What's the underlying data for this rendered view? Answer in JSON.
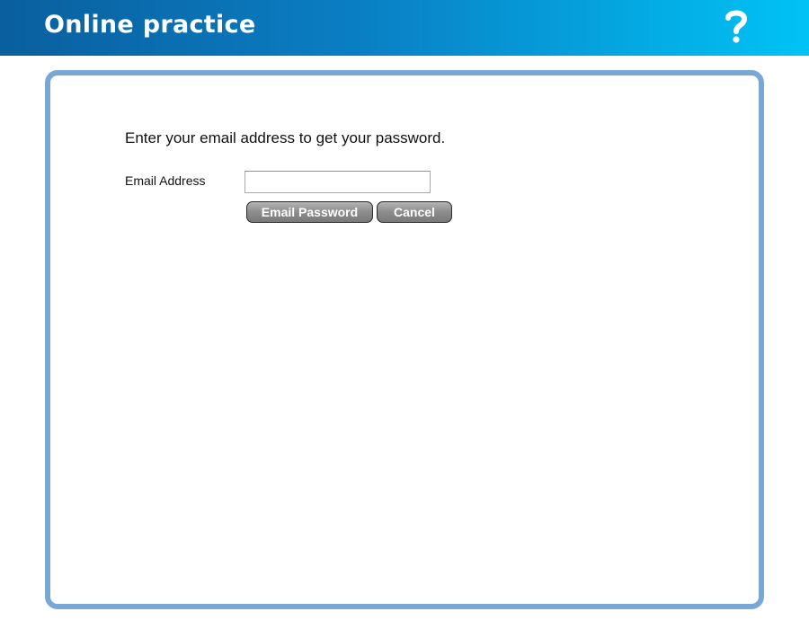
{
  "header": {
    "title": "Online practice",
    "help_icon": "question-mark-icon",
    "gradient_colors": [
      "#0a5f9e",
      "#00c3f5"
    ]
  },
  "form": {
    "instruction": "Enter your email address to get your password.",
    "email_label": "Email Address",
    "email_value": "",
    "email_placeholder": "",
    "email_button_label": "Email Password",
    "cancel_button_label": "Cancel"
  },
  "colors": {
    "panel_border": "#79a8d6",
    "button_gray": "#8c8c8c"
  }
}
